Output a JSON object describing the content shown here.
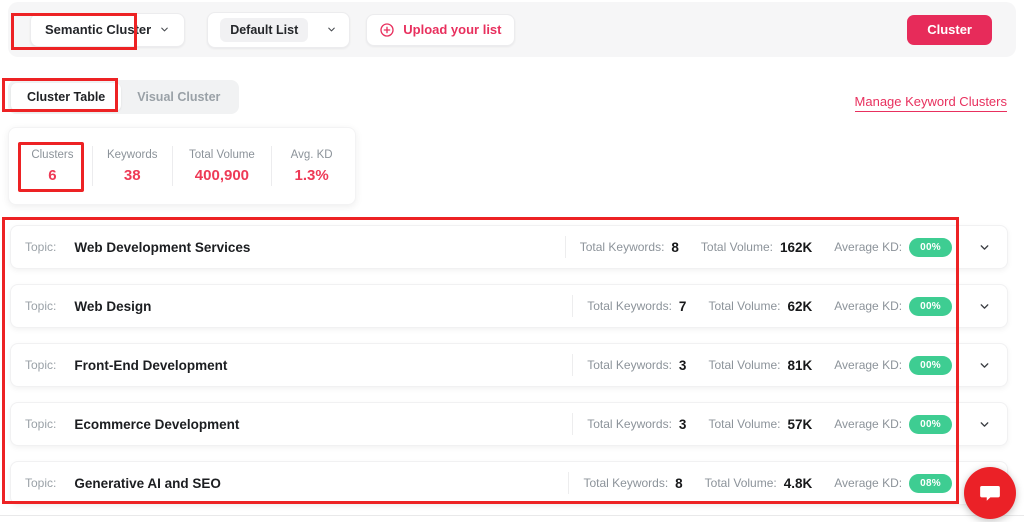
{
  "colors": {
    "brand": "#e72b5a",
    "annotation_red": "#ed2224",
    "kd_badge_green": "#3ecd92",
    "chat_red": "#eb2127"
  },
  "toolbar": {
    "cluster_type_selector": "Semantic Cluster",
    "list_selector": "Default List",
    "upload_label": "Upload your list",
    "cluster_button": "Cluster"
  },
  "tabs": {
    "cluster_table": "Cluster Table",
    "visual_cluster": "Visual Cluster"
  },
  "manage_link": "Manage Keyword Clusters",
  "summary": {
    "stats": [
      {
        "label": "Clusters",
        "value": "6"
      },
      {
        "label": "Keywords",
        "value": "38"
      },
      {
        "label": "Total Volume",
        "value": "400,900"
      },
      {
        "label": "Avg. KD",
        "value": "1.3%"
      }
    ]
  },
  "table": {
    "topic_label": "Topic:",
    "total_keywords_label": "Total Keywords:",
    "total_volume_label": "Total Volume:",
    "average_kd_label": "Average KD:",
    "rows": [
      {
        "topic": "Web Development Services",
        "total_keywords": "8",
        "total_volume": "162K",
        "average_kd": "00%"
      },
      {
        "topic": "Web Design",
        "total_keywords": "7",
        "total_volume": "62K",
        "average_kd": "00%"
      },
      {
        "topic": "Front-End Development",
        "total_keywords": "3",
        "total_volume": "81K",
        "average_kd": "00%"
      },
      {
        "topic": "Ecommerce Development",
        "total_keywords": "3",
        "total_volume": "57K",
        "average_kd": "00%"
      },
      {
        "topic": "Generative AI and SEO",
        "total_keywords": "8",
        "total_volume": "4.8K",
        "average_kd": "08%"
      }
    ]
  }
}
